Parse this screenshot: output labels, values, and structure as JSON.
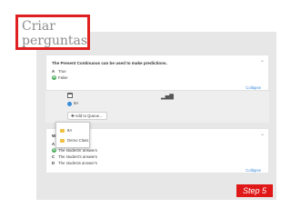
{
  "header": {
    "title_line1": "Criar",
    "title_line2": "perguntas"
  },
  "question1": {
    "text": "The Present Continuous can be used to make predictions.",
    "answers": [
      {
        "letter": "A",
        "text": "True"
      },
      {
        "letter": "B",
        "text": "False"
      }
    ],
    "collapse_label": "Collapse"
  },
  "toolbar": {
    "class_name": "8A",
    "add_to_queue_label": "✚ Add to Queue...",
    "dropdown_items": [
      "8A",
      "Demo Class"
    ]
  },
  "question2": {
    "text": "Which are",
    "answers": [
      {
        "letter": "A",
        "text": "The st"
      },
      {
        "letter": "B",
        "text": "The students' answers"
      },
      {
        "letter": "C",
        "text": "The student's answers"
      },
      {
        "letter": "D",
        "text": "The students answer's"
      }
    ],
    "collapse_label": "Collapse"
  },
  "step_badge": "Step 5",
  "colors": {
    "accent": "#e02020",
    "link": "#3a8bd8",
    "correct": "#44aa55"
  }
}
